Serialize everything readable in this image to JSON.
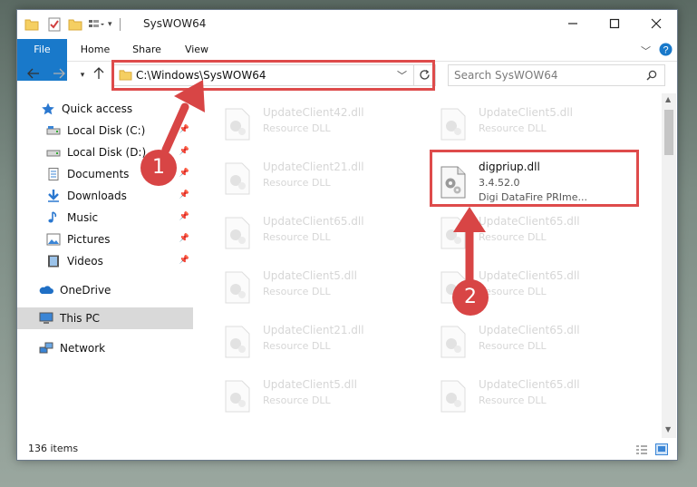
{
  "window": {
    "title": "SysWOW64"
  },
  "ribbon": {
    "tabs": [
      "File",
      "Home",
      "Share",
      "View"
    ]
  },
  "address": {
    "path": "C:\\Windows\\SysWOW64",
    "search_placeholder": "Search SysWOW64"
  },
  "nav": {
    "items": [
      {
        "label": "Quick access"
      },
      {
        "label": "Local Disk (C:)"
      },
      {
        "label": "Local Disk (D:)"
      },
      {
        "label": "Documents"
      },
      {
        "label": "Downloads"
      },
      {
        "label": "Music"
      },
      {
        "label": "Pictures"
      },
      {
        "label": "Videos"
      },
      {
        "label": "OneDrive"
      },
      {
        "label": "This PC"
      },
      {
        "label": "Network"
      }
    ]
  },
  "files": {
    "left": [
      {
        "name": "UpdateClient42.dll",
        "type": "Resource DLL"
      },
      {
        "name": "UpdateClient21.dll",
        "type": "Resource DLL"
      },
      {
        "name": "UpdateClient65.dll",
        "type": "Resource DLL"
      },
      {
        "name": "UpdateClient5.dll",
        "type": "Resource DLL"
      },
      {
        "name": "UpdateClient21.dll",
        "type": "Resource DLL"
      },
      {
        "name": "UpdateClient5.dll",
        "type": "Resource DLL"
      }
    ],
    "right": [
      {
        "name": "UpdateClient5.dll",
        "type": "Resource DLL"
      },
      {
        "name": "UpdateClient65.dll",
        "type": "Resource DLL"
      },
      {
        "name": "UpdateClient65.dll",
        "type": "Resource DLL"
      },
      {
        "name": "UpdateClient65.dll",
        "type": "Resource DLL"
      },
      {
        "name": "UpdateClient65.dll",
        "type": "Resource DLL"
      }
    ],
    "highlight": {
      "name": "digpriup.dll",
      "version": "3.4.52.0",
      "desc": "Digi DataFire PRIme..."
    }
  },
  "status": {
    "count": "136 items"
  },
  "annotations": {
    "step1": "1",
    "step2": "2",
    "color": "#d84545"
  }
}
